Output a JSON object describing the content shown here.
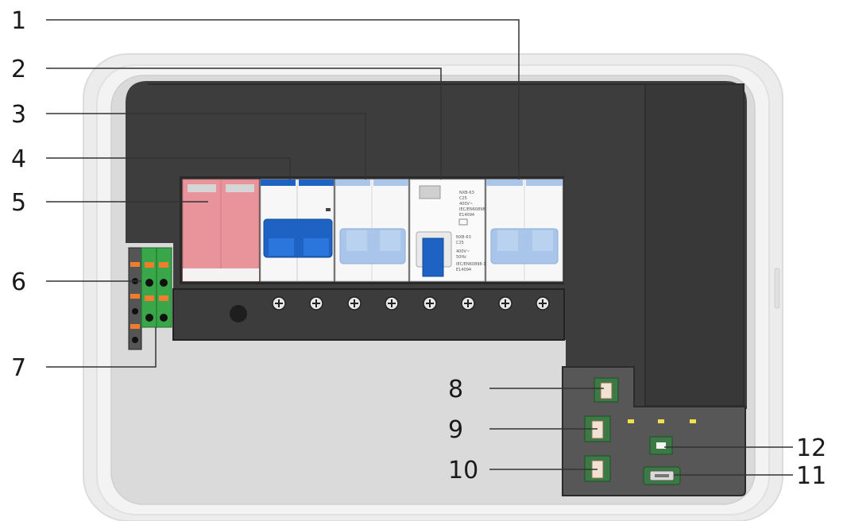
{
  "callouts": {
    "c1": "1",
    "c2": "2",
    "c3": "3",
    "c4": "4",
    "c5": "5",
    "c6": "6",
    "c7": "7",
    "c8": "8",
    "c9": "9",
    "c10": "10",
    "c11": "11",
    "c12": "12"
  },
  "breaker_2": {
    "model": "NXB-63",
    "rating": "C25",
    "voltage": "400V~",
    "frequency": "50Hz",
    "standard": "IEC/EN60898-1",
    "code": "E14094"
  },
  "colors": {
    "enclosure_outer": "#e7e7e7",
    "panel_dark": "#3d3d3d",
    "spd_module": "#e9939b",
    "breaker_blue": "#1e63c4",
    "breaker_light_blue": "#a9c6ea",
    "terminal_green": "#3aa64a",
    "terminal_orange": "#ef7d2d",
    "port_green": "#3b7a45",
    "led_yellow": "#f2e04a"
  }
}
